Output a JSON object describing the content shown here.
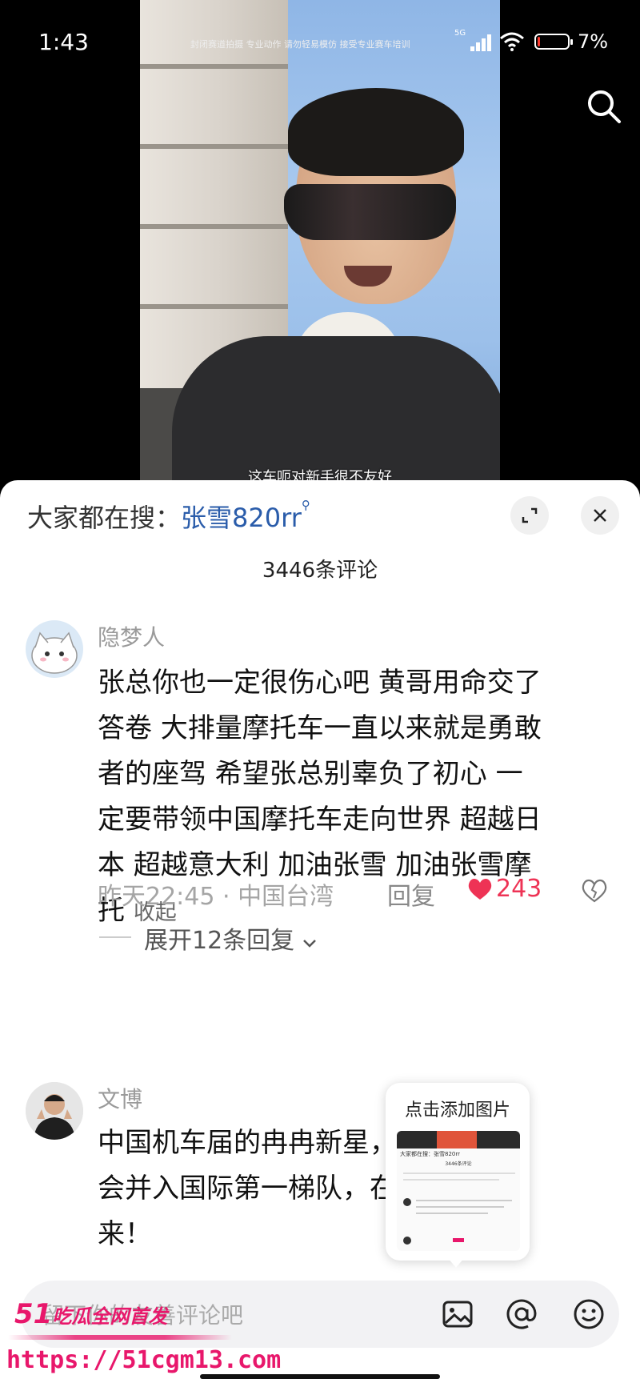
{
  "status_bar": {
    "time": "1:43",
    "ticker": "封闭赛道拍摄 专业动作 请勿轻易模仿 接受专业赛车培训",
    "network": "5G",
    "battery": "7%",
    "battery_level": 0.07
  },
  "video": {
    "subtitle": "这车呃对新手很不友好"
  },
  "sheet": {
    "hot_search_label": "大家都在搜：",
    "hot_search_term": "张雪820rr",
    "comment_count": "3446条评论"
  },
  "comments": [
    {
      "name": "隐梦人",
      "lines": [
        "张总你也一定很伤心吧 黄哥用命交了",
        "答卷 大排量摩托车一直以来就是勇敢",
        "者的座驾 希望张总别辜负了初心 一",
        "定要带领中国摩托车走向世界 超越日",
        "本 超越意大利 加油张雪 加油张雪摩",
        "托"
      ],
      "collapse": "收起",
      "time_location": "昨天22:45 · 中国台湾",
      "reply": "回复",
      "likes": "243",
      "expand_replies": "展开12条回复"
    },
    {
      "name": "文博",
      "lines": [
        "中国机车届的冉冉新星，相信自己",
        "会并入国际第一梯队，在不久的将",
        "来！"
      ]
    }
  ],
  "tooltip": {
    "title": "点击添加图片",
    "thumb_header": "大家都在搜：张雪820rr",
    "thumb_count": "3446条评论"
  },
  "input": {
    "placeholder": "留下你的友善评论吧"
  },
  "watermark": {
    "line1": "51",
    "line1_tail": "吃瓜全网首发",
    "line2": "https://51cgm13.com"
  },
  "colors": {
    "like": "#ee3355",
    "link": "#2a5caa",
    "watermark": "#e8176b"
  }
}
